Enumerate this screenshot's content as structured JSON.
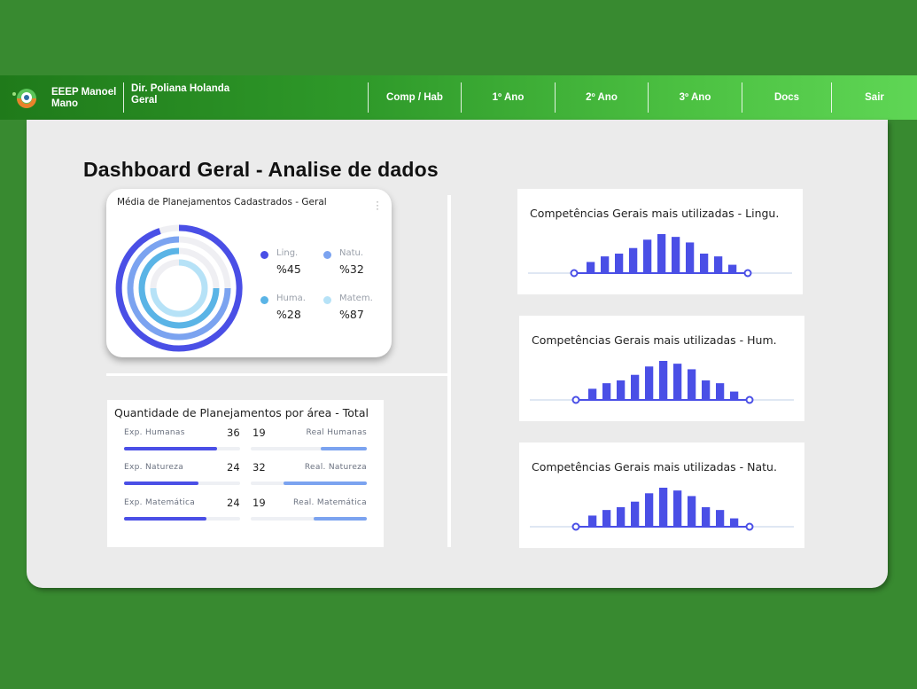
{
  "header": {
    "school": "EEEP Manoel Mano",
    "director": "Dir. Poliana Holanda Geral",
    "nav": [
      "Comp / Hab",
      "1º Ano",
      "2º Ano",
      "3º Ano",
      "Docs",
      "Sair"
    ]
  },
  "page_title": "Dashboard Geral - Analise de dados",
  "donut_card": {
    "title": "Média de Planejamentos Cadastrados - Geral",
    "legend": [
      {
        "label": "Ling.",
        "value": "%45",
        "color": "#4a4fe6"
      },
      {
        "label": "Natu.",
        "value": "%32",
        "color": "#7ba3f0"
      },
      {
        "label": "Huma.",
        "value": "%28",
        "color": "#5ab4e6"
      },
      {
        "label": "Matem.",
        "value": "%87",
        "color": "#b6e2f7"
      }
    ]
  },
  "qty_card": {
    "title": "Quantidade de Planejamentos por área - Total",
    "rows": [
      {
        "exp_label": "Exp. Humanas",
        "exp_value": "36",
        "real_value": "19",
        "real_label": "Real Humanas",
        "exp_fill": 0.8,
        "real_fill": 0.4
      },
      {
        "exp_label": "Exp. Natureza",
        "exp_value": "24",
        "real_value": "32",
        "real_label": "Real. Natureza",
        "exp_fill": 0.64,
        "real_fill": 0.72
      },
      {
        "exp_label": "Exp. Matemática",
        "exp_value": "24",
        "real_value": "19",
        "real_label": "Real. Matemática",
        "exp_fill": 0.71,
        "real_fill": 0.46
      }
    ]
  },
  "competencias": [
    {
      "title": "Competências Gerais mais utilizadas - Lingu."
    },
    {
      "title": "Competências Gerais mais utilizadas - Hum."
    },
    {
      "title": "Competências Gerais mais utilizadas - Natu."
    }
  ],
  "chart_data": [
    {
      "type": "bar",
      "title": "Competências Gerais mais utilizadas - Lingu.",
      "values": [
        2,
        3,
        3.5,
        4.5,
        6,
        7,
        6.5,
        5.5,
        3.5,
        3,
        1.5
      ]
    },
    {
      "type": "bar",
      "title": "Competências Gerais mais utilizadas - Hum.",
      "values": [
        2,
        3,
        3.5,
        4.5,
        6,
        7,
        6.5,
        5.5,
        3.5,
        3,
        1.5
      ]
    },
    {
      "type": "bar",
      "title": "Competências Gerais mais utilizadas - Natu.",
      "values": [
        2,
        3,
        3.5,
        4.5,
        6,
        7,
        6.5,
        5.5,
        3.5,
        3,
        1.5
      ]
    }
  ],
  "colors": {
    "bar": "#4a4fe6",
    "axis": "#dfe7f3",
    "green_dark": "#1f7a1a",
    "green_light": "#5fd655"
  }
}
